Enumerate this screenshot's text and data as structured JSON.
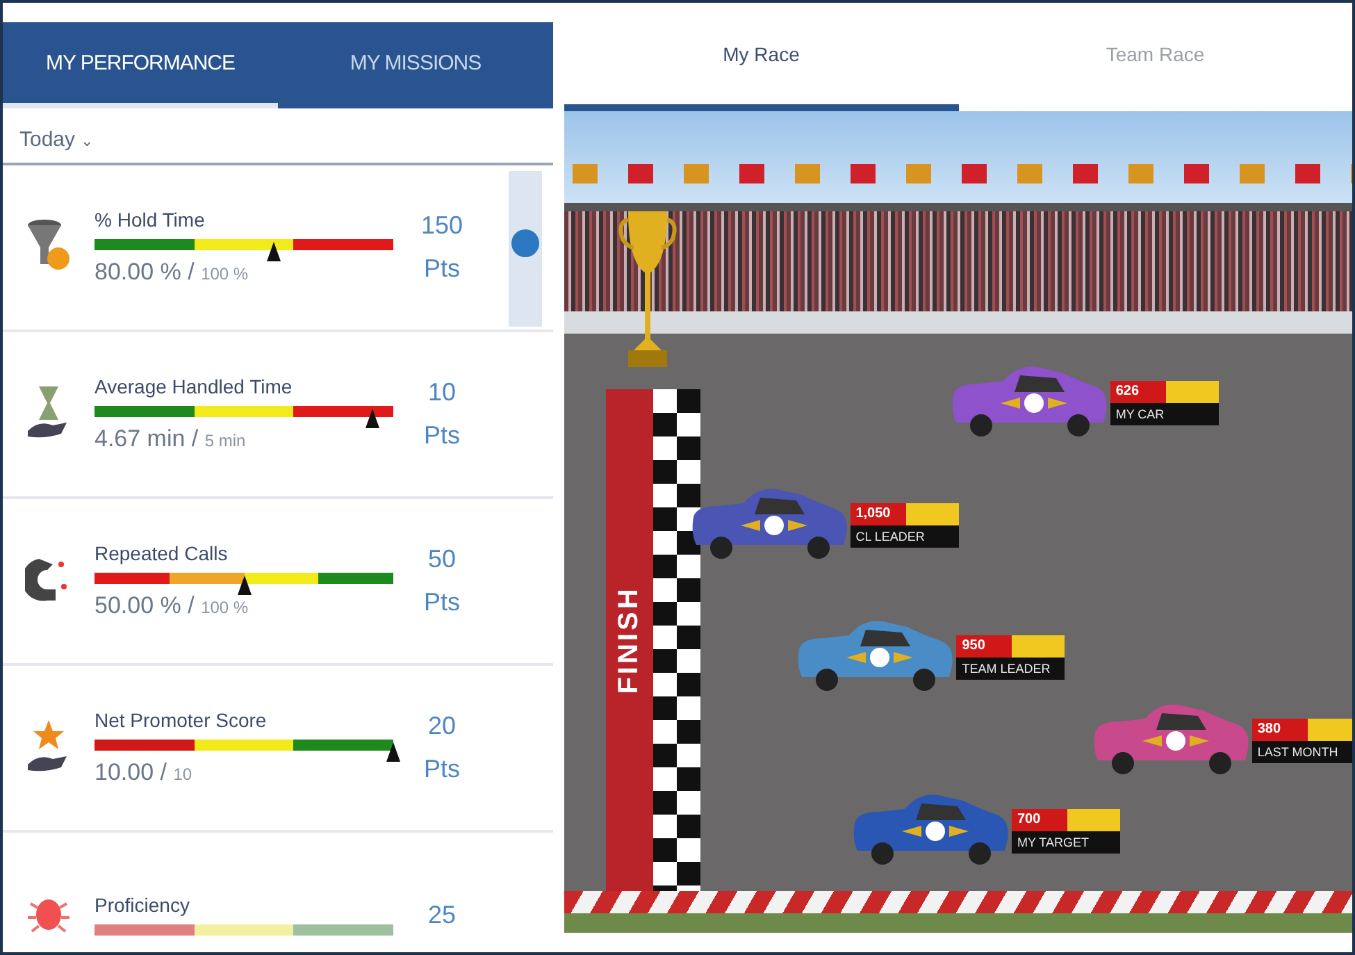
{
  "left_tabs": [
    {
      "label": "MY PERFORMANCE",
      "selected": true
    },
    {
      "label": "MY MISSIONS",
      "selected": false
    }
  ],
  "period": {
    "value": "Today",
    "caret": "⌄"
  },
  "metrics": [
    {
      "name": "% Hold Time",
      "value": "80.00 % /",
      "target": "100 %",
      "points": "150",
      "unit": "Pts",
      "level": 0.6,
      "segments": [
        {
          "color": "#1e8a1e"
        },
        {
          "color": "#f2ea1a"
        },
        {
          "color": "#e01a1a"
        }
      ]
    },
    {
      "name": "Average Handled Time",
      "value": "4.67 min /",
      "target": "5 min",
      "points": "10",
      "unit": "Pts",
      "level": 0.93,
      "segments": [
        {
          "color": "#1e8a1e"
        },
        {
          "color": "#f2ea1a"
        },
        {
          "color": "#e01a1a"
        }
      ]
    },
    {
      "name": "Repeated Calls",
      "value": "50.00 % /",
      "target": "100 %",
      "points": "50",
      "unit": "Pts",
      "level": 0.5,
      "segments": [
        {
          "color": "#e01a1a"
        },
        {
          "color": "#eda52a"
        },
        {
          "color": "#f2ea1a"
        },
        {
          "color": "#1e8a1e"
        }
      ]
    },
    {
      "name": "Net Promoter Score",
      "value": "10.00 /",
      "target": "10",
      "points": "20",
      "unit": "Pts",
      "level": 1.0,
      "segments": [
        {
          "color": "#d01a1a"
        },
        {
          "color": "#f2ea1a"
        },
        {
          "color": "#1e8a1e"
        }
      ]
    },
    {
      "name": "Proficiency",
      "points": "25",
      "segments": [
        {
          "color": "#e08080"
        },
        {
          "color": "#f4f0a0"
        },
        {
          "color": "#9ec09e"
        }
      ]
    }
  ],
  "race_tabs": [
    {
      "label": "My Race",
      "selected": true
    },
    {
      "label": "Team Race",
      "selected": false
    }
  ],
  "finish_label": "FINISH",
  "cars": [
    {
      "score": "626",
      "label": "MY CAR",
      "color": "#8e52cc"
    },
    {
      "score": "1,050",
      "label": "CL LEADER",
      "color": "#4a55b4"
    },
    {
      "score": "950",
      "label": "TEAM LEADER",
      "color": "#4a8cc6"
    },
    {
      "score": "380",
      "label": "LAST MONTH",
      "color": "#c84a8c"
    },
    {
      "score": "700",
      "label": "MY TARGET",
      "color": "#2a56b4"
    }
  ]
}
